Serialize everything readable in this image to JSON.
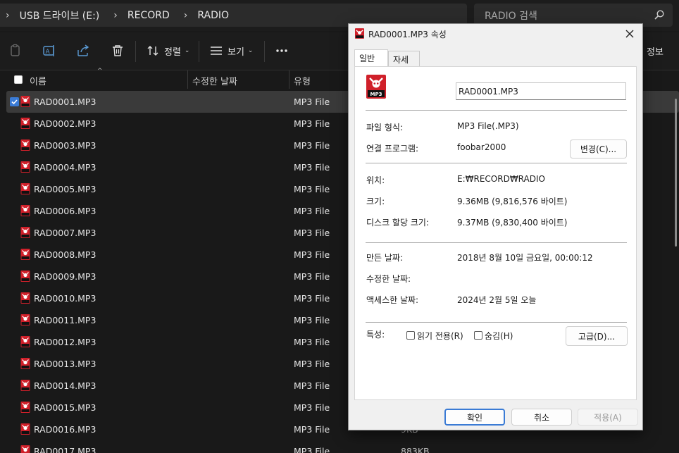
{
  "address": {
    "crumbs": [
      "USB 드라이브 (E:)",
      "RECORD",
      "RADIO"
    ],
    "search_placeholder": "RADIO 검색"
  },
  "toolbar": {
    "sort_label": "정렬",
    "view_label": "보기",
    "details_label": "정보",
    "icons": [
      "copy-icon",
      "rename-icon",
      "share-icon",
      "delete-icon",
      "sort-icon",
      "view-icon",
      "more-icon"
    ]
  },
  "columns": {
    "name": "이름",
    "modified": "수정한 날짜",
    "type": "유형"
  },
  "files": [
    {
      "name": "RAD0001.MP3",
      "type": "MP3 File",
      "size": "",
      "selected": true
    },
    {
      "name": "RAD0002.MP3",
      "type": "MP3 File",
      "size": ""
    },
    {
      "name": "RAD0003.MP3",
      "type": "MP3 File",
      "size": ""
    },
    {
      "name": "RAD0004.MP3",
      "type": "MP3 File",
      "size": ""
    },
    {
      "name": "RAD0005.MP3",
      "type": "MP3 File",
      "size": ""
    },
    {
      "name": "RAD0006.MP3",
      "type": "MP3 File",
      "size": ""
    },
    {
      "name": "RAD0007.MP3",
      "type": "MP3 File",
      "size": ""
    },
    {
      "name": "RAD0008.MP3",
      "type": "MP3 File",
      "size": ""
    },
    {
      "name": "RAD0009.MP3",
      "type": "MP3 File",
      "size": ""
    },
    {
      "name": "RAD0010.MP3",
      "type": "MP3 File",
      "size": ""
    },
    {
      "name": "RAD0011.MP3",
      "type": "MP3 File",
      "size": ""
    },
    {
      "name": "RAD0012.MP3",
      "type": "MP3 File",
      "size": ""
    },
    {
      "name": "RAD0013.MP3",
      "type": "MP3 File",
      "size": ""
    },
    {
      "name": "RAD0014.MP3",
      "type": "MP3 File",
      "size": ""
    },
    {
      "name": "RAD0015.MP3",
      "type": "MP3 File",
      "size": ""
    },
    {
      "name": "RAD0016.MP3",
      "type": "MP3 File",
      "size": "9KB"
    },
    {
      "name": "RAD0017.MP3",
      "type": "MP3 File",
      "size": "883KB"
    }
  ],
  "dialog": {
    "title": "RAD0001.MP3 속성",
    "tabs": [
      "일반",
      "자세히"
    ],
    "file_name": "RAD0001.MP3",
    "file_type_label": "파일 형식:",
    "file_type_value": "MP3 File(.MP3)",
    "opens_with_label": "연결 프로그램:",
    "opens_with_value": "foobar2000",
    "change_button": "변경(C)...",
    "location_label": "위치:",
    "location_value": "E:₩RECORD₩RADIO",
    "size_label": "크기:",
    "size_value": "9.36MB (9,816,576 바이트)",
    "size_on_disk_label": "디스크 할당 크기:",
    "size_on_disk_value": "9.37MB (9,830,400 바이트)",
    "created_label": "만든 날짜:",
    "created_value": "2018년 8월 10일 금요일, 00:00:12",
    "modified_label": "수정한 날짜:",
    "modified_value": "",
    "accessed_label": "액세스한 날짜:",
    "accessed_value": "2024년 2월 5일 오늘",
    "attributes_label": "특성:",
    "readonly_label": "읽기 전용(R)",
    "hidden_label": "숨김(H)",
    "advanced_button": "고급(D)...",
    "ok_button": "확인",
    "cancel_button": "취소",
    "apply_button": "적용(A)"
  },
  "colors": {
    "accent": "#3a7bd5",
    "icon_red": "#d0202a"
  }
}
